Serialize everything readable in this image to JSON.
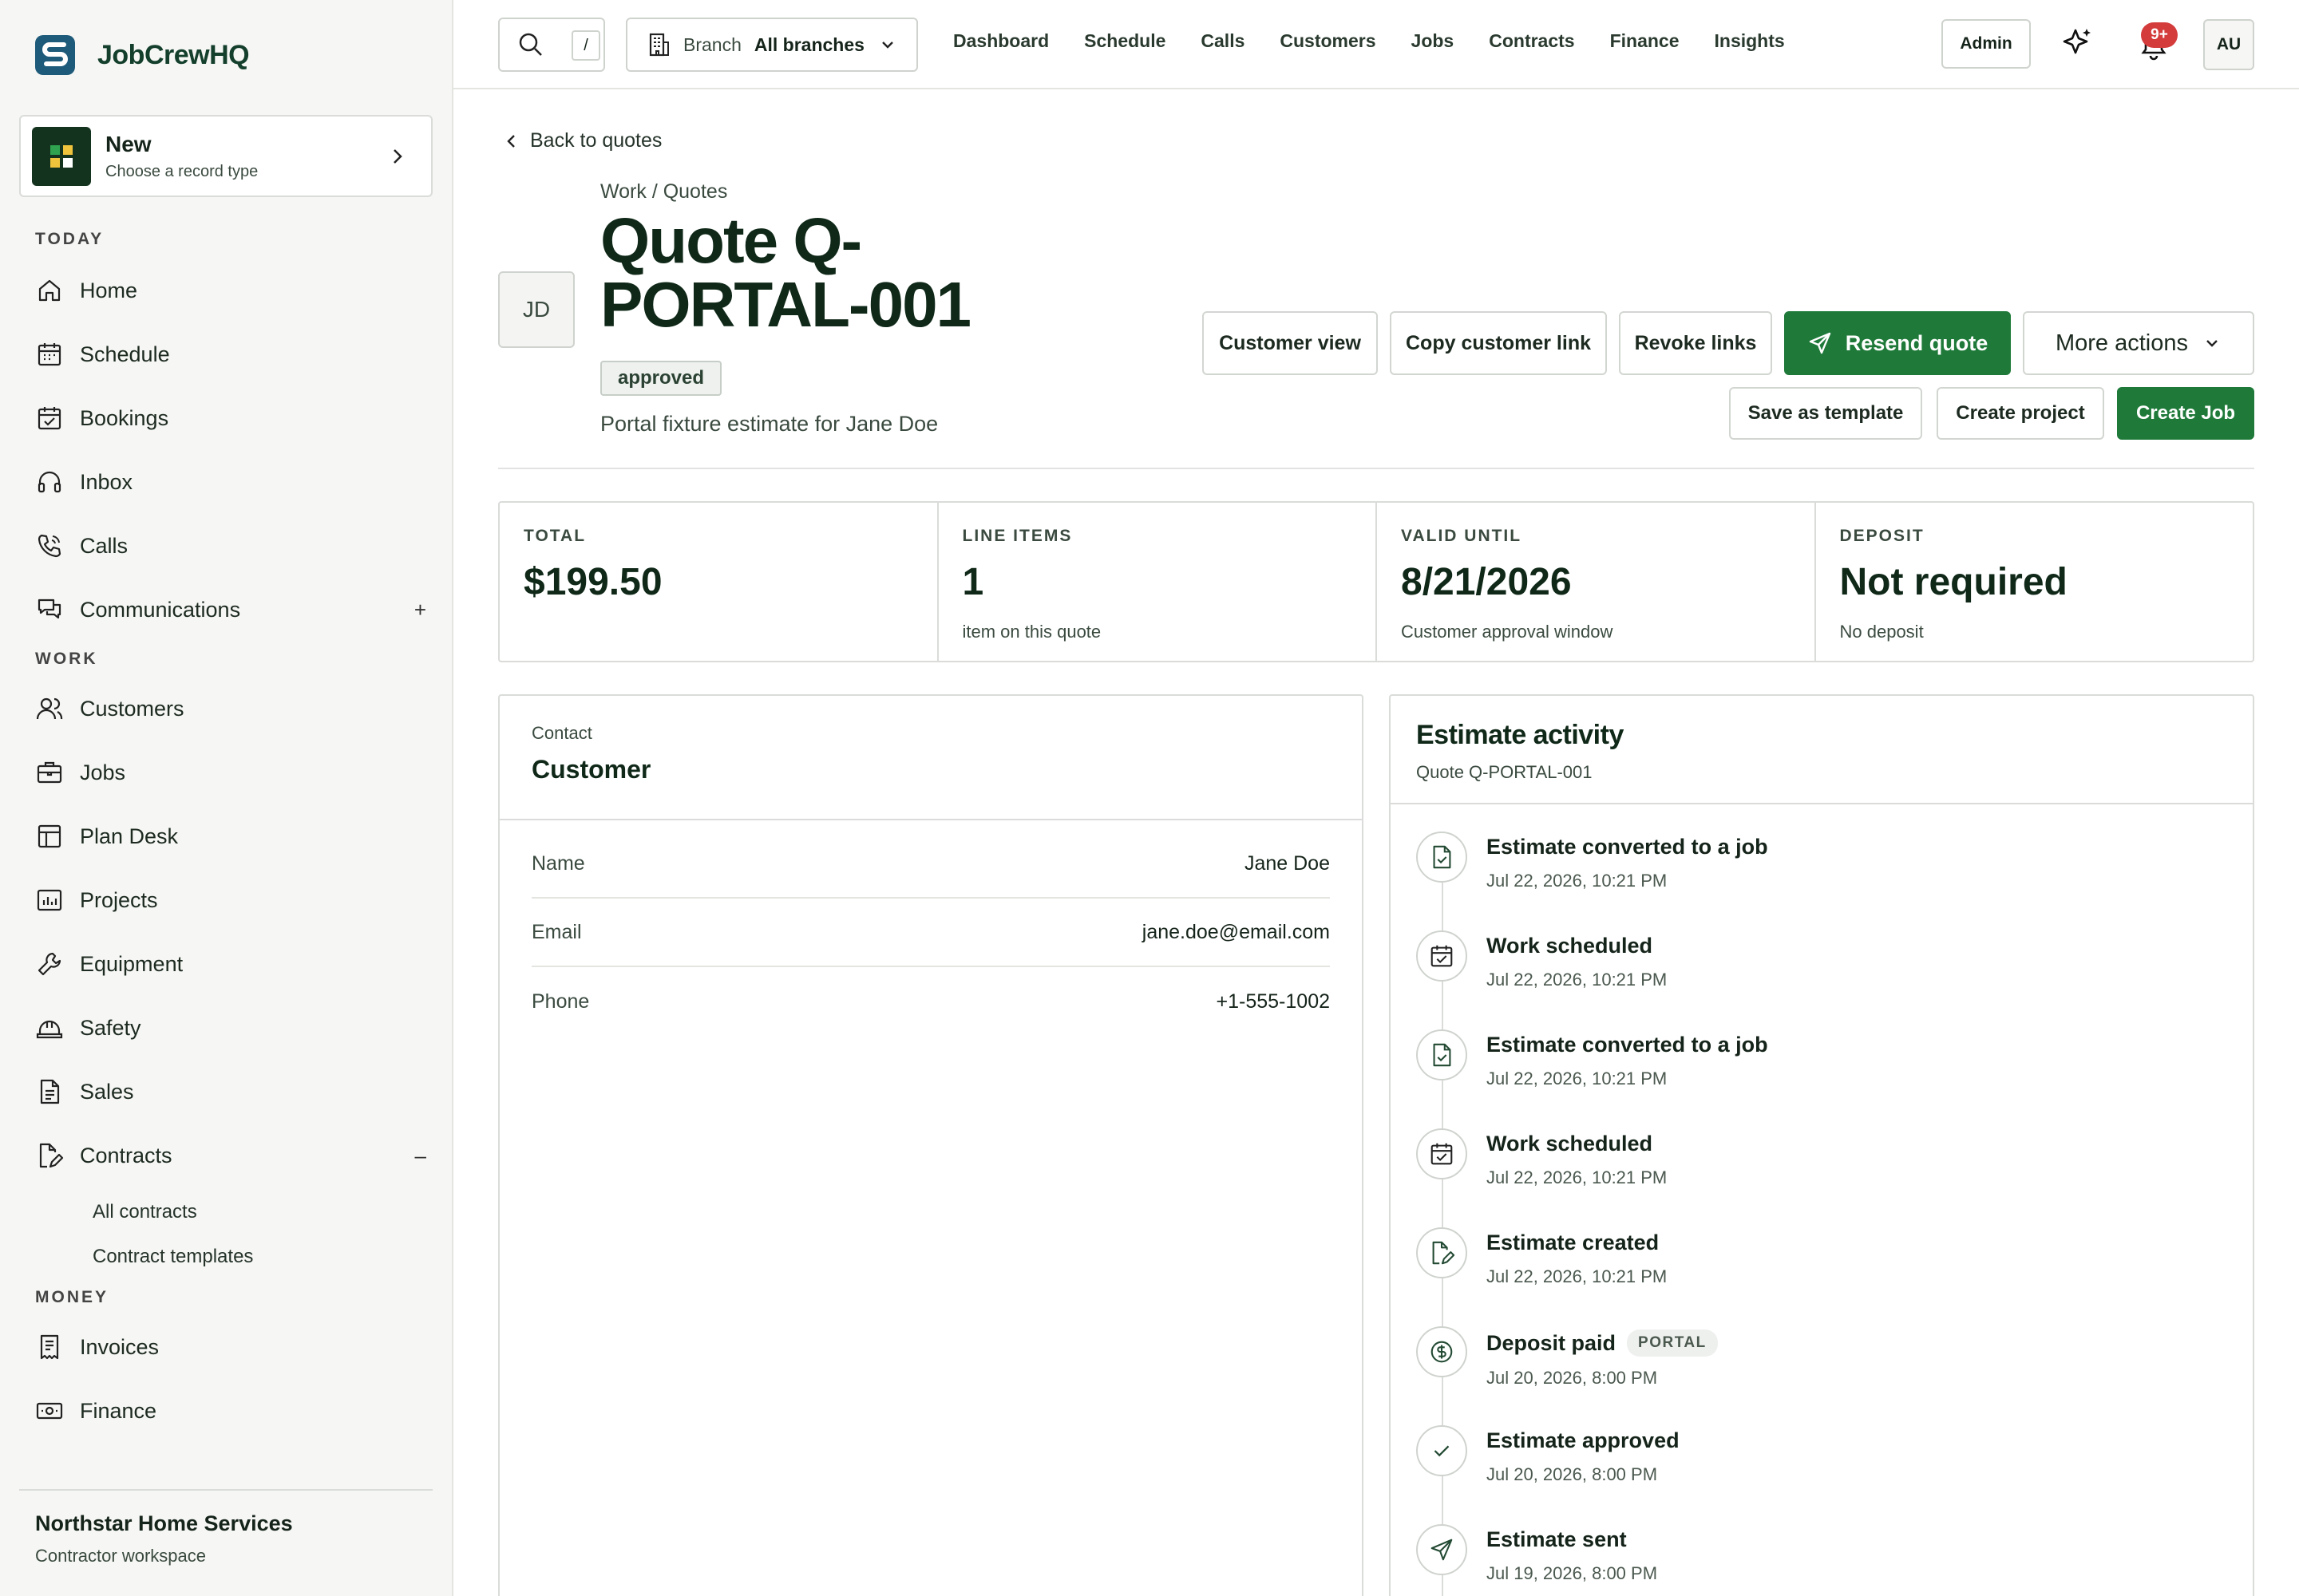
{
  "brand": {
    "name": "JobCrewHQ"
  },
  "new_card": {
    "title": "New",
    "subtitle": "Choose a record type"
  },
  "sidebar": {
    "sections": {
      "today": "TODAY",
      "work": "WORK",
      "money": "MONEY"
    },
    "today_items": [
      {
        "label": "Home",
        "icon": "home-icon"
      },
      {
        "label": "Schedule",
        "icon": "calendar-icon"
      },
      {
        "label": "Bookings",
        "icon": "calendar-check-icon"
      },
      {
        "label": "Inbox",
        "icon": "headset-icon"
      },
      {
        "label": "Calls",
        "icon": "phone-icon"
      },
      {
        "label": "Communications",
        "icon": "chat-icon"
      }
    ],
    "work_items": [
      {
        "label": "Customers",
        "icon": "users-icon"
      },
      {
        "label": "Jobs",
        "icon": "briefcase-icon"
      },
      {
        "label": "Plan Desk",
        "icon": "layout-icon"
      },
      {
        "label": "Projects",
        "icon": "chart-icon"
      },
      {
        "label": "Equipment",
        "icon": "wrench-icon"
      },
      {
        "label": "Safety",
        "icon": "hardhat-icon"
      },
      {
        "label": "Sales",
        "icon": "document-icon"
      },
      {
        "label": "Contracts",
        "icon": "contract-icon"
      }
    ],
    "contracts_sub": [
      "All contracts",
      "Contract templates"
    ],
    "money_items": [
      {
        "label": "Invoices",
        "icon": "invoice-icon"
      },
      {
        "label": "Finance",
        "icon": "banknote-icon"
      }
    ],
    "comm_toggle": "+",
    "contracts_toggle": "–",
    "org": {
      "name": "Northstar Home Services",
      "subtitle": "Contractor workspace"
    }
  },
  "topbar": {
    "search_key": "/",
    "branch_label": "Branch",
    "branch_value": "All branches",
    "nav": [
      "Dashboard",
      "Schedule",
      "Calls",
      "Customers",
      "Jobs",
      "Contracts",
      "Finance",
      "Insights"
    ],
    "admin": "Admin",
    "notifications": "9+",
    "user_initials": "AU"
  },
  "quote": {
    "back": "Back to quotes",
    "breadcrumb": "Work / Quotes",
    "avatar": "JD",
    "title": "Quote Q-PORTAL-001",
    "status": "approved",
    "description": "Portal fixture estimate for Jane Doe"
  },
  "actions": {
    "customer_view": "Customer view",
    "copy_link": "Copy customer link",
    "revoke": "Revoke links",
    "resend": "Resend quote",
    "more": "More actions",
    "save_template": "Save as template",
    "create_project": "Create project",
    "create_job": "Create Job"
  },
  "stats": [
    {
      "label": "TOTAL",
      "value": "$199.50",
      "sub": ""
    },
    {
      "label": "LINE ITEMS",
      "value": "1",
      "sub": "item on this quote"
    },
    {
      "label": "VALID UNTIL",
      "value": "8/21/2026",
      "sub": "Customer approval window"
    },
    {
      "label": "DEPOSIT",
      "value": "Not required",
      "sub": "No deposit"
    }
  ],
  "contact": {
    "kicker": "Contact",
    "title": "Customer",
    "rows": [
      {
        "key": "Name",
        "value": "Jane Doe"
      },
      {
        "key": "Email",
        "value": "jane.doe@email.com"
      },
      {
        "key": "Phone",
        "value": "+1-555-1002"
      }
    ]
  },
  "activity": {
    "title": "Estimate activity",
    "subtitle": "Quote Q-PORTAL-001",
    "events": [
      {
        "title": "Estimate converted to a job",
        "date": "Jul 22, 2026, 10:21 PM",
        "icon": "file-check-icon",
        "tag": ""
      },
      {
        "title": "Work scheduled",
        "date": "Jul 22, 2026, 10:21 PM",
        "icon": "calendar-check-icon",
        "tag": ""
      },
      {
        "title": "Estimate converted to a job",
        "date": "Jul 22, 2026, 10:21 PM",
        "icon": "file-check-icon",
        "tag": ""
      },
      {
        "title": "Work scheduled",
        "date": "Jul 22, 2026, 10:21 PM",
        "icon": "calendar-check-icon",
        "tag": ""
      },
      {
        "title": "Estimate created",
        "date": "Jul 22, 2026, 10:21 PM",
        "icon": "file-edit-icon",
        "tag": ""
      },
      {
        "title": "Deposit paid",
        "date": "Jul 20, 2026, 8:00 PM",
        "icon": "dollar-icon",
        "tag": "PORTAL"
      },
      {
        "title": "Estimate approved",
        "date": "Jul 20, 2026, 8:00 PM",
        "icon": "check-icon",
        "tag": ""
      },
      {
        "title": "Estimate sent",
        "date": "Jul 19, 2026, 8:00 PM",
        "icon": "send-icon",
        "tag": ""
      }
    ]
  },
  "colors": {
    "accent": "#1f7a3a",
    "brand": "#133f2c",
    "badge": "#d43c3c"
  }
}
